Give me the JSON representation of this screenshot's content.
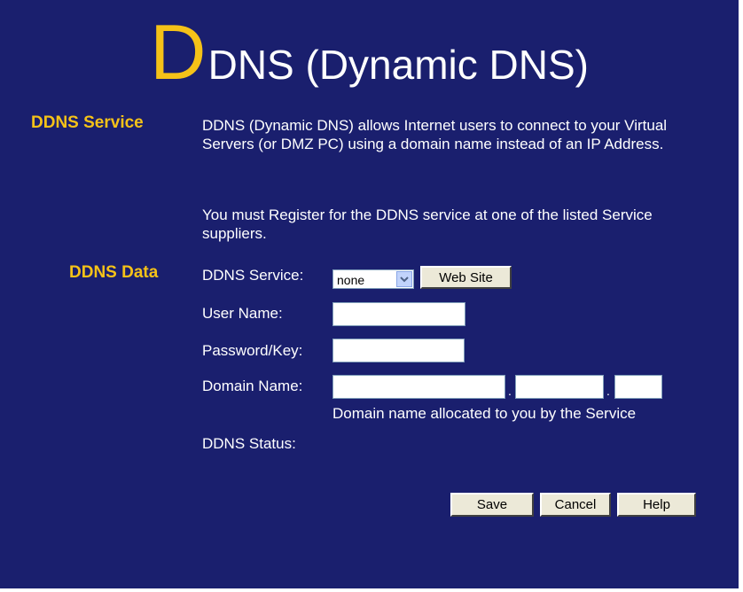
{
  "header": {
    "title_first_letter": "D",
    "title_rest": "DNS (Dynamic DNS)"
  },
  "ddns_service": {
    "label": "DDNS Service",
    "description_1": "DDNS (Dynamic DNS) allows Internet users to connect to your Virtual Servers (or DMZ PC) using a domain name instead of an IP Address.",
    "description_2": "You must Register for the DDNS service at one of the listed Service suppliers."
  },
  "ddns_data": {
    "label": "DDNS Data",
    "service_label": "DDNS Service:",
    "service_selected": "none",
    "website_button": "Web Site",
    "username_label": "User Name:",
    "username_value": "",
    "password_label": "Password/Key:",
    "password_value": "",
    "domain_label": "Domain Name:",
    "domain_part1": "",
    "domain_part2": "",
    "domain_part3": "",
    "domain_separator": ".",
    "domain_hint": "Domain name allocated to you by the Service",
    "status_label": "DDNS Status:",
    "status_value": ""
  },
  "actions": {
    "save": "Save",
    "cancel": "Cancel",
    "help": "Help"
  },
  "colors": {
    "background": "#1a1f6e",
    "accent": "#f5c218",
    "text": "#ffffff"
  },
  "icons": {
    "dropdown": "chevron-down-icon"
  }
}
